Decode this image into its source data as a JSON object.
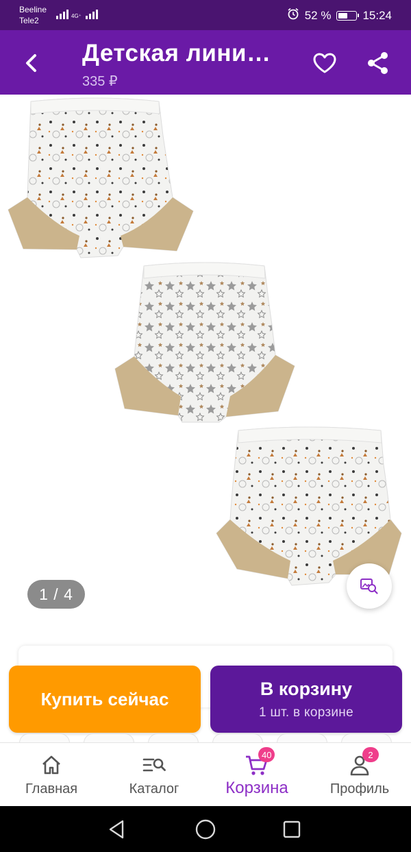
{
  "status_bar": {
    "carrier_1": "Beeline",
    "carrier_2": "Tele2",
    "network": "4G⁺",
    "battery_percent": "52 %",
    "battery_level": 0.52,
    "time": "15:24"
  },
  "header": {
    "title": "Детская лини…",
    "price": "335 ₽",
    "back_icon": "chevron-left-icon",
    "favorite_icon": "heart-outline-icon",
    "share_icon": "share-icon"
  },
  "gallery": {
    "counter": "1 / 4",
    "current": 1,
    "total": 4,
    "products": [
      {
        "name": "shorts-bears-print",
        "print": "bears"
      },
      {
        "name": "shorts-stars-print",
        "print": "stars"
      },
      {
        "name": "shorts-bears-print-2",
        "print": "bears"
      }
    ]
  },
  "actions": {
    "buy_now": "Купить сейчас",
    "to_cart": "В корзину",
    "to_cart_sub": "1 шт. в корзине"
  },
  "bottom_nav": {
    "items": [
      {
        "label": "Главная",
        "icon": "home-icon"
      },
      {
        "label": "Каталог",
        "icon": "catalog-search-icon"
      },
      {
        "label": "Корзина",
        "icon": "cart-icon",
        "badge": "40",
        "active": true
      },
      {
        "label": "Профиль",
        "icon": "profile-icon",
        "badge": "2"
      }
    ]
  },
  "colors": {
    "status_bar": "#4a1470",
    "app_bar": "#6a1aa6",
    "buy_now": "#ff9a00",
    "to_cart": "#5c189a",
    "active_nav": "#8d2fc6",
    "badge": "#ef3e8b"
  }
}
